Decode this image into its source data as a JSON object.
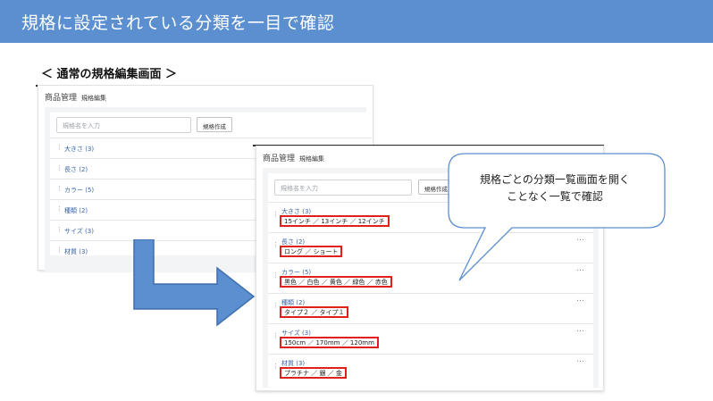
{
  "banner": {
    "title": "規格に設定されている分類を一目で確認"
  },
  "section_title": "＜ 通常の規格編集画面 ＞",
  "back_window": {
    "breadcrumb": "商品管理",
    "subtitle": "規格編集",
    "search": {
      "placeholder": "規格名を入力",
      "value": ""
    },
    "create_button": "規格作成",
    "items": [
      {
        "label": "大きさ (3)"
      },
      {
        "label": "長さ (2)"
      },
      {
        "label": "カラー (5)"
      },
      {
        "label": "種類 (2)"
      },
      {
        "label": "サイズ (3)"
      },
      {
        "label": "材質 (3)"
      }
    ]
  },
  "front_window": {
    "breadcrumb": "商品管理",
    "subtitle": "規格編集",
    "search": {
      "placeholder": "規格名を入力",
      "value": ""
    },
    "create_button": "規格作成",
    "more_icon": "…",
    "items": [
      {
        "label": "大きさ (3)",
        "values": "15インチ ／ 13インチ ／ 12インチ"
      },
      {
        "label": "長さ (2)",
        "values": "ロング ／ ショート"
      },
      {
        "label": "カラー (5)",
        "values": "黒色 ／ 白色 ／ 黄色 ／ 緑色 ／ 赤色"
      },
      {
        "label": "種類 (2)",
        "values": "タイプ２ ／ タイプ１"
      },
      {
        "label": "サイズ (3)",
        "values": "150cm ／ 170mm ／ 120mm"
      },
      {
        "label": "材質 (3)",
        "values": "プラチナ ／ 銀 ／ 金"
      }
    ]
  },
  "callout": {
    "line1": "規格ごとの分類一覧画面を開く",
    "line2": "ことなく一覧で確認"
  },
  "colors": {
    "banner": "#5b8fd0",
    "arrow": "#5b8fd0",
    "highlight": "#e0201a",
    "link": "#3a64a4"
  }
}
